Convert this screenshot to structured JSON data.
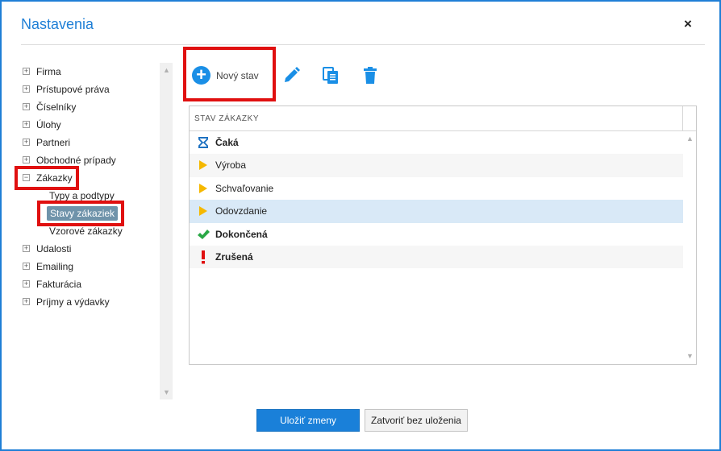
{
  "dialog": {
    "title": "Nastavenia",
    "close_label": "×"
  },
  "tree": {
    "items": [
      {
        "label": "Firma",
        "expander": "+"
      },
      {
        "label": "Prístupové práva",
        "expander": "+"
      },
      {
        "label": "Číselníky",
        "expander": "+"
      },
      {
        "label": "Úlohy",
        "expander": "+"
      },
      {
        "label": "Partneri",
        "expander": "+"
      },
      {
        "label": "Obchodné prípady",
        "expander": "+"
      },
      {
        "label": "Zákazky",
        "expander": "−"
      },
      {
        "label": "Udalosti",
        "expander": "+"
      },
      {
        "label": "Emailing",
        "expander": "+"
      },
      {
        "label": "Fakturácia",
        "expander": "+"
      },
      {
        "label": "Príjmy a výdavky",
        "expander": "+"
      }
    ],
    "children": [
      {
        "label": "Typy a podtypy"
      },
      {
        "label": "Stavy zákaziek",
        "selected": true
      },
      {
        "label": "Vzorové zákazky"
      }
    ]
  },
  "toolbar": {
    "new_label": "Nový stav",
    "new_icon": "plus-circle-icon",
    "edit_icon": "pencil-icon",
    "copy_icon": "copy-icon",
    "delete_icon": "trash-icon"
  },
  "grid": {
    "column_header": "Stav zákazky",
    "rows": [
      {
        "label": "Čaká",
        "bold": true,
        "icon": "hourglass-icon"
      },
      {
        "label": "Výroba",
        "bold": false,
        "icon": "play-icon"
      },
      {
        "label": "Schvaľovanie",
        "bold": false,
        "icon": "play-icon"
      },
      {
        "label": "Odovzdanie",
        "bold": false,
        "icon": "play-icon",
        "selected": true
      },
      {
        "label": "Dokončená",
        "bold": true,
        "icon": "check-icon"
      },
      {
        "label": "Zrušená",
        "bold": true,
        "icon": "exclamation-icon"
      }
    ]
  },
  "footer": {
    "save_label": "Uložiť zmeny",
    "close_label": "Zatvoriť bez uloženia"
  },
  "colors": {
    "accent": "#1f7fd6",
    "highlight": "#e01010",
    "play": "#f5b800",
    "check": "#2aa845",
    "alert": "#e01010",
    "selected_row": "#d9e9f7",
    "selected_tree": "#6f93aa"
  }
}
